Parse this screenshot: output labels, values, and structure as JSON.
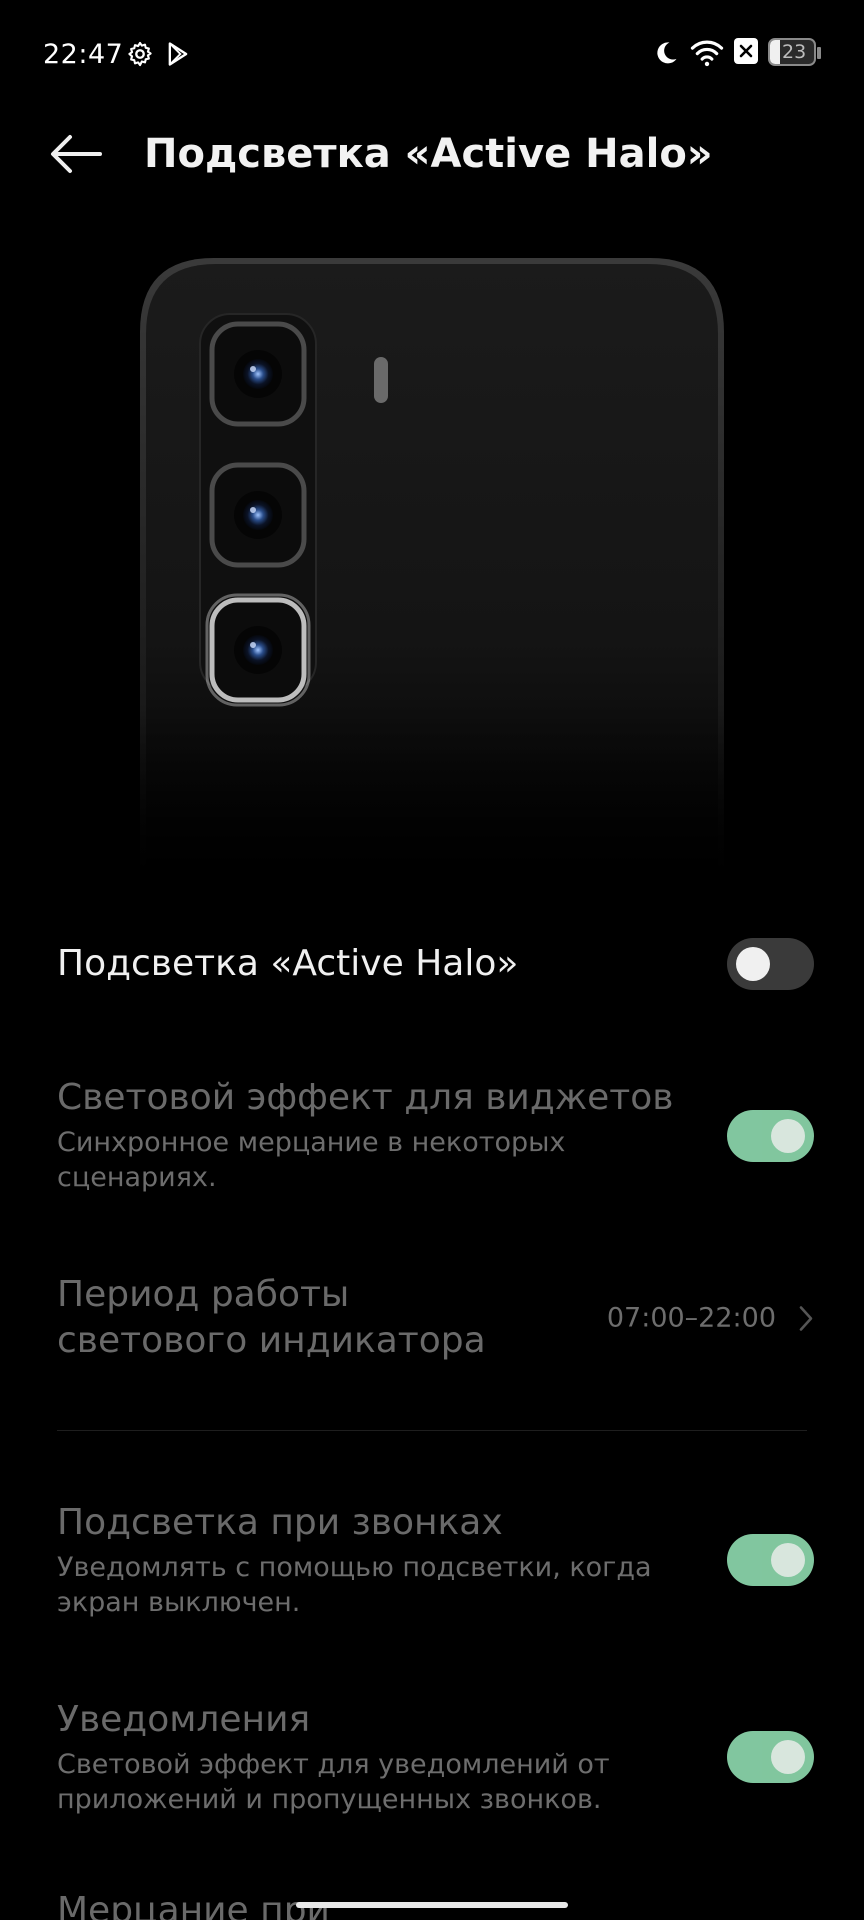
{
  "status_bar": {
    "time": "22:47",
    "battery_level": "23",
    "icons": [
      "gear-icon",
      "play-store-icon",
      "moon-icon",
      "wifi-icon",
      "sim-off-icon",
      "battery-icon"
    ]
  },
  "header": {
    "title": "Подсветка «Active Halo»"
  },
  "settings": {
    "main_toggle": {
      "label": "Подсветка «Active Halo»",
      "state": "off"
    },
    "widgets_effect": {
      "label": "Световой эффект для виджетов",
      "sub": "Синхронное мерцание в некоторых сценариях.",
      "state": "on"
    },
    "period": {
      "label_line1": "Период работы",
      "label_line2": "светового индикатора",
      "value": "07:00–22:00"
    },
    "calls": {
      "label": "Подсветка при звонках",
      "sub": "Уведомлять с помощью подсветки, когда экран выключен.",
      "state": "on"
    },
    "notifications": {
      "label": "Уведомления",
      "sub": "Световой эффект для уведомлений от приложений и пропущенных звонков.",
      "state": "on"
    },
    "partial_next": {
      "label": "Мерцание при"
    }
  },
  "colors": {
    "background": "#000000",
    "toggle_on": "#8fdcb0",
    "toggle_off": "#3a3a3a",
    "text_dim": "#6a6a6a"
  }
}
